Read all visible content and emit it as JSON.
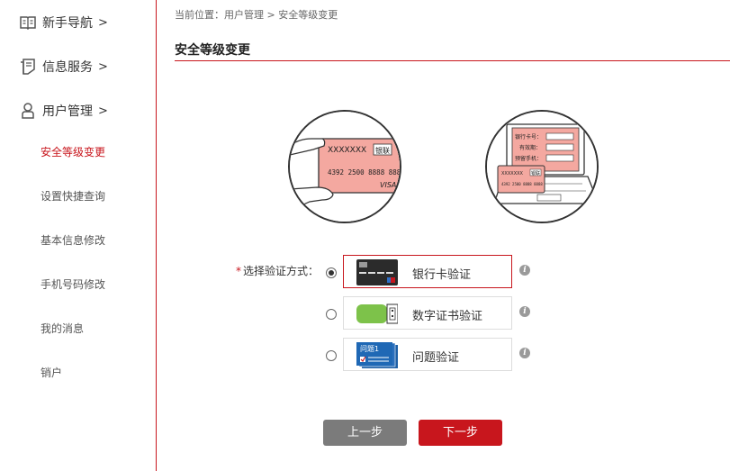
{
  "sidebar": {
    "groups": [
      {
        "label": "新手导航",
        "arrow": ">",
        "icon": "book-icon"
      },
      {
        "label": "信息服务",
        "arrow": ">",
        "icon": "document-icon"
      },
      {
        "label": "用户管理",
        "arrow": ">",
        "icon": "user-icon"
      }
    ],
    "sub_items": [
      {
        "label": "安全等级变更",
        "active": true
      },
      {
        "label": "设置快捷查询",
        "active": false
      },
      {
        "label": "基本信息修改",
        "active": false
      },
      {
        "label": "手机号码修改",
        "active": false
      },
      {
        "label": "我的消息",
        "active": false
      },
      {
        "label": "销户",
        "active": false
      }
    ]
  },
  "breadcrumb": {
    "text": "当前位置：用户管理 > 安全等级变更"
  },
  "page_title": "安全等级变更",
  "illustrations": {
    "card": {
      "number_mask": "XXXXXXX",
      "brand": "银联",
      "card_number": "4392 2500 8888 888",
      "network": "VISA"
    },
    "laptop": {
      "field1": "银行卡号：",
      "field2": "有效期：",
      "field3": "预留手机：",
      "card_mask": "XXXXXXX",
      "card_brand": "银联",
      "card_number": "4392 2500 8888 8888"
    }
  },
  "form": {
    "required_mark": "*",
    "label": "选择验证方式："
  },
  "options": [
    {
      "label": "银行卡验证",
      "icon": "bank-card-icon",
      "checked": true
    },
    {
      "label": "数字证书验证",
      "icon": "usb-key-icon",
      "checked": false
    },
    {
      "label": "问题验证",
      "icon": "question-card-icon",
      "checked": false,
      "thumb_text": "问题1"
    }
  ],
  "info_symbol": "i",
  "buttons": {
    "prev": "上一步",
    "next": "下一步"
  },
  "colors": {
    "accent": "#c8161d",
    "prev_button": "#7b7b7b",
    "card_pink": "#f4a8a0"
  }
}
